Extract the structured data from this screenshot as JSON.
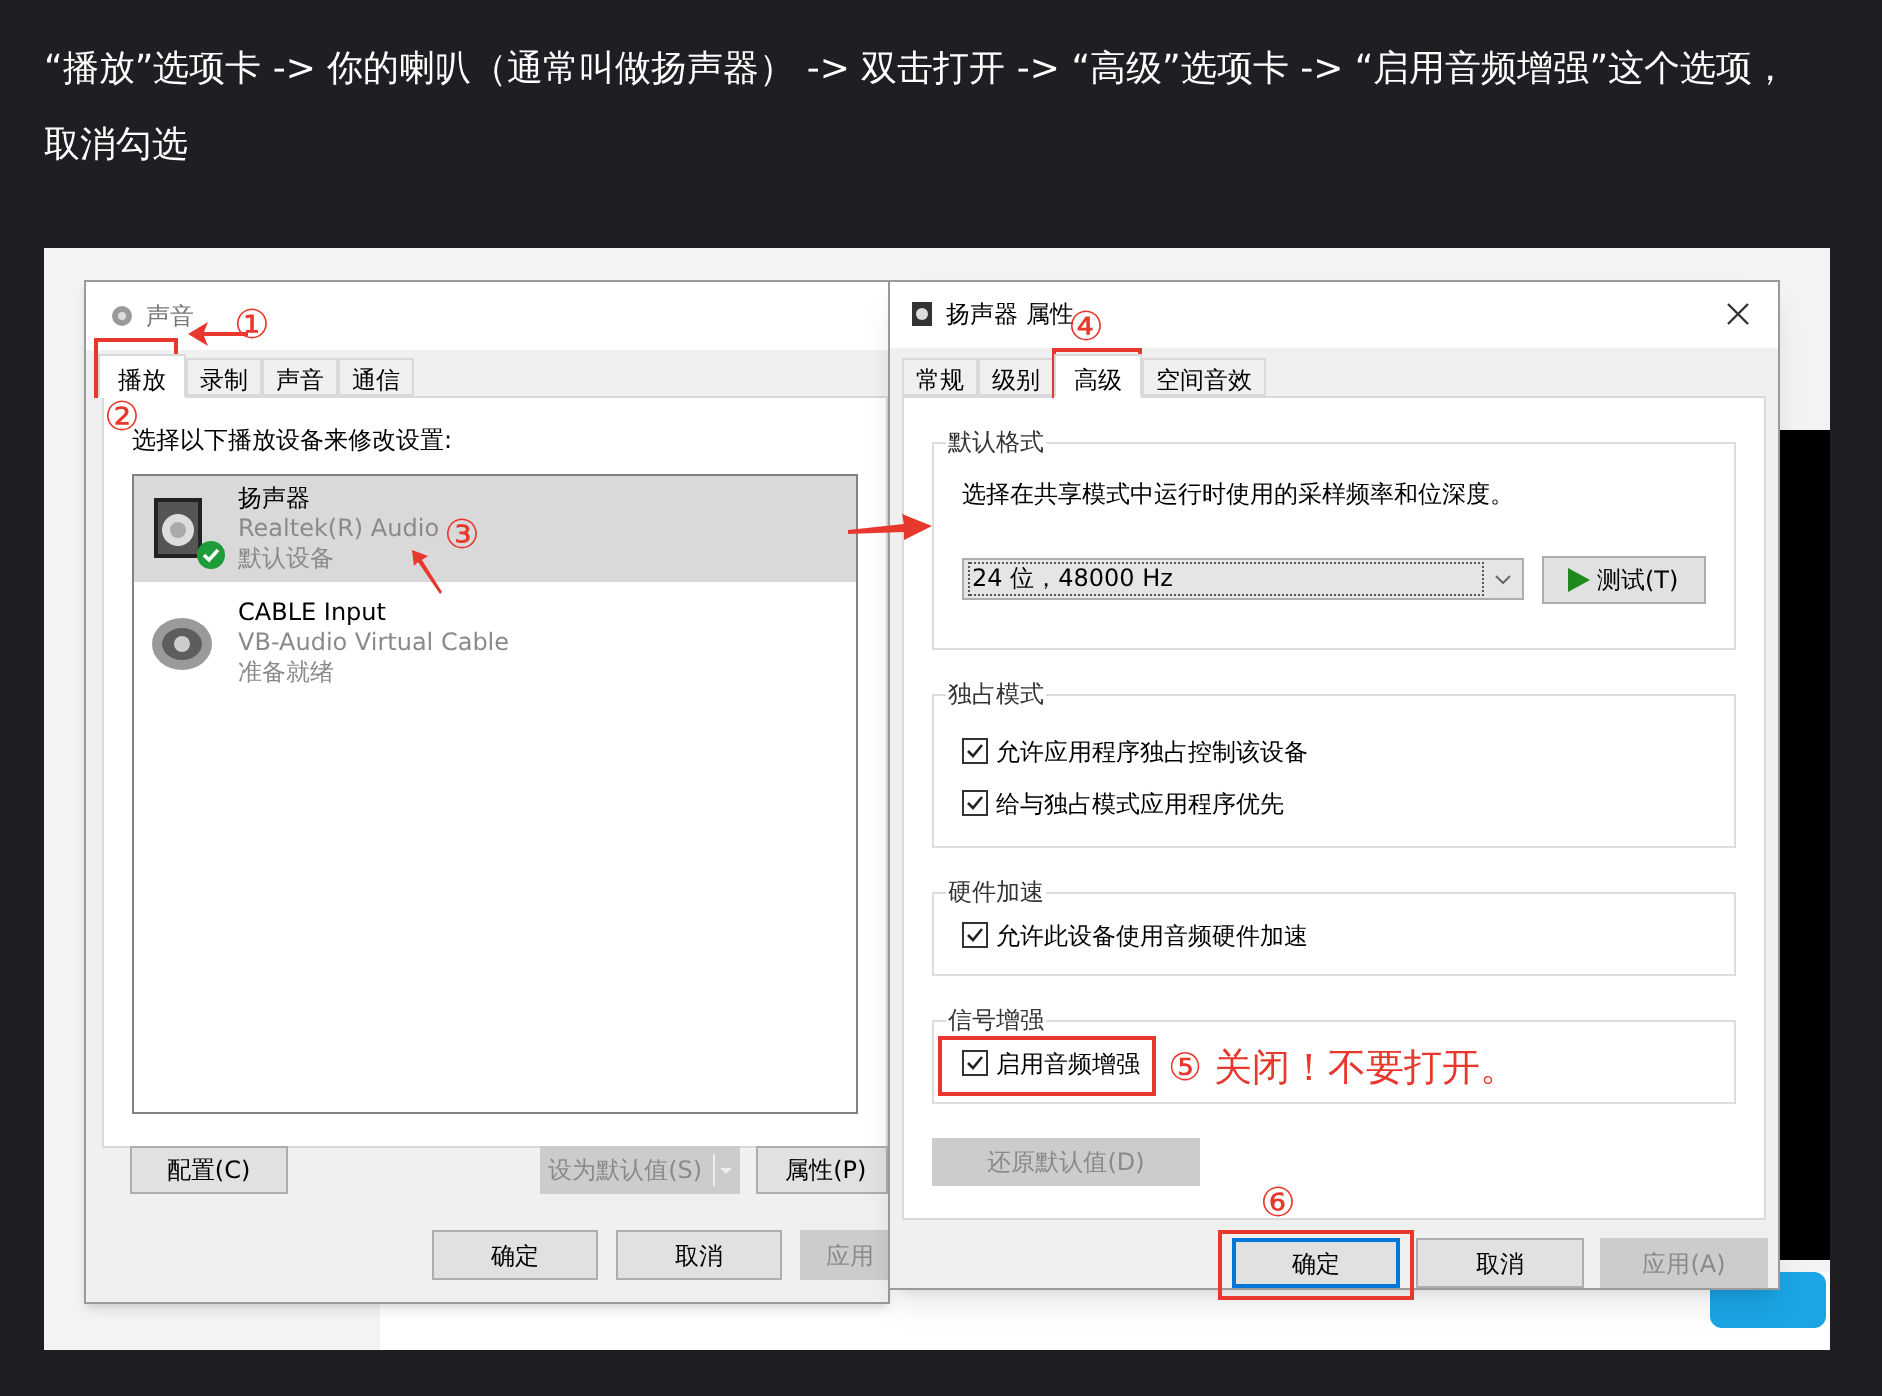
{
  "heading": "“播放”选项卡 -> 你的喇叭（通常叫做扬声器） -> 双击打开 -> “高级”选项卡 -> “启用音频增强”这个选项，取消勾选",
  "sound_dialog": {
    "title": "声音",
    "tabs": [
      {
        "label": "播放",
        "selected": true
      },
      {
        "label": "录制",
        "selected": false
      },
      {
        "label": "声音",
        "selected": false
      },
      {
        "label": "通信",
        "selected": false
      }
    ],
    "instruction": "选择以下播放设备来修改设置:",
    "devices": [
      {
        "kind": "speaker",
        "name": "扬声器",
        "driver": "Realtek(R) Audio",
        "status": "默认设备",
        "selected": true,
        "is_default": true
      },
      {
        "kind": "cable",
        "name": "CABLE Input",
        "driver": "VB-Audio Virtual Cable",
        "status": "准备就绪",
        "selected": false,
        "is_default": false
      }
    ],
    "configure_button": {
      "label": "配置(C)",
      "disabled": false
    },
    "set_default_button": {
      "label": "设为默认值(S)",
      "disabled": true
    },
    "properties_button": {
      "label": "属性(P)",
      "disabled": false
    },
    "footer_buttons": [
      {
        "label": "确定",
        "disabled": false
      },
      {
        "label": "取消",
        "disabled": false
      },
      {
        "label": "应用",
        "disabled": true
      }
    ]
  },
  "properties_dialog": {
    "title": "扬声器 属性",
    "tabs": [
      {
        "label": "常规",
        "selected": false
      },
      {
        "label": "级别",
        "selected": false
      },
      {
        "label": "高级",
        "selected": true
      },
      {
        "label": "空间音效",
        "selected": false
      }
    ],
    "sections": [
      {
        "kind": "format",
        "title": "默认格式",
        "description": "选择在共享模式中运行时使用的采样频率和位深度。",
        "value": "24 位，48000 Hz",
        "button": "测试(T)"
      },
      {
        "kind": "checks",
        "title": "独占模式",
        "options": [
          {
            "label": "允许应用程序独占控制该设备",
            "checked": true
          },
          {
            "label": "给与独占模式应用程序优先",
            "checked": true
          }
        ]
      },
      {
        "kind": "checks",
        "title": "硬件加速",
        "options": [
          {
            "label": "允许此设备使用音频硬件加速",
            "checked": true
          }
        ]
      },
      {
        "kind": "checks",
        "title": "信号增强",
        "options": [
          {
            "label": "启用音频增强",
            "checked": true
          }
        ]
      }
    ],
    "restore_button": {
      "label": "还原默认值(D)",
      "disabled": true
    },
    "footer_buttons": [
      {
        "label": "确定",
        "disabled": false,
        "focused": true
      },
      {
        "label": "取消",
        "disabled": false,
        "focused": false
      },
      {
        "label": "应用(A)",
        "disabled": true,
        "focused": false
      }
    ]
  },
  "annotations": [
    {
      "label": "①"
    },
    {
      "label": "②"
    },
    {
      "label": "③"
    },
    {
      "label": "④"
    },
    {
      "label": "⑥"
    }
  ],
  "note": "⑤ 关闭！不要打开。"
}
